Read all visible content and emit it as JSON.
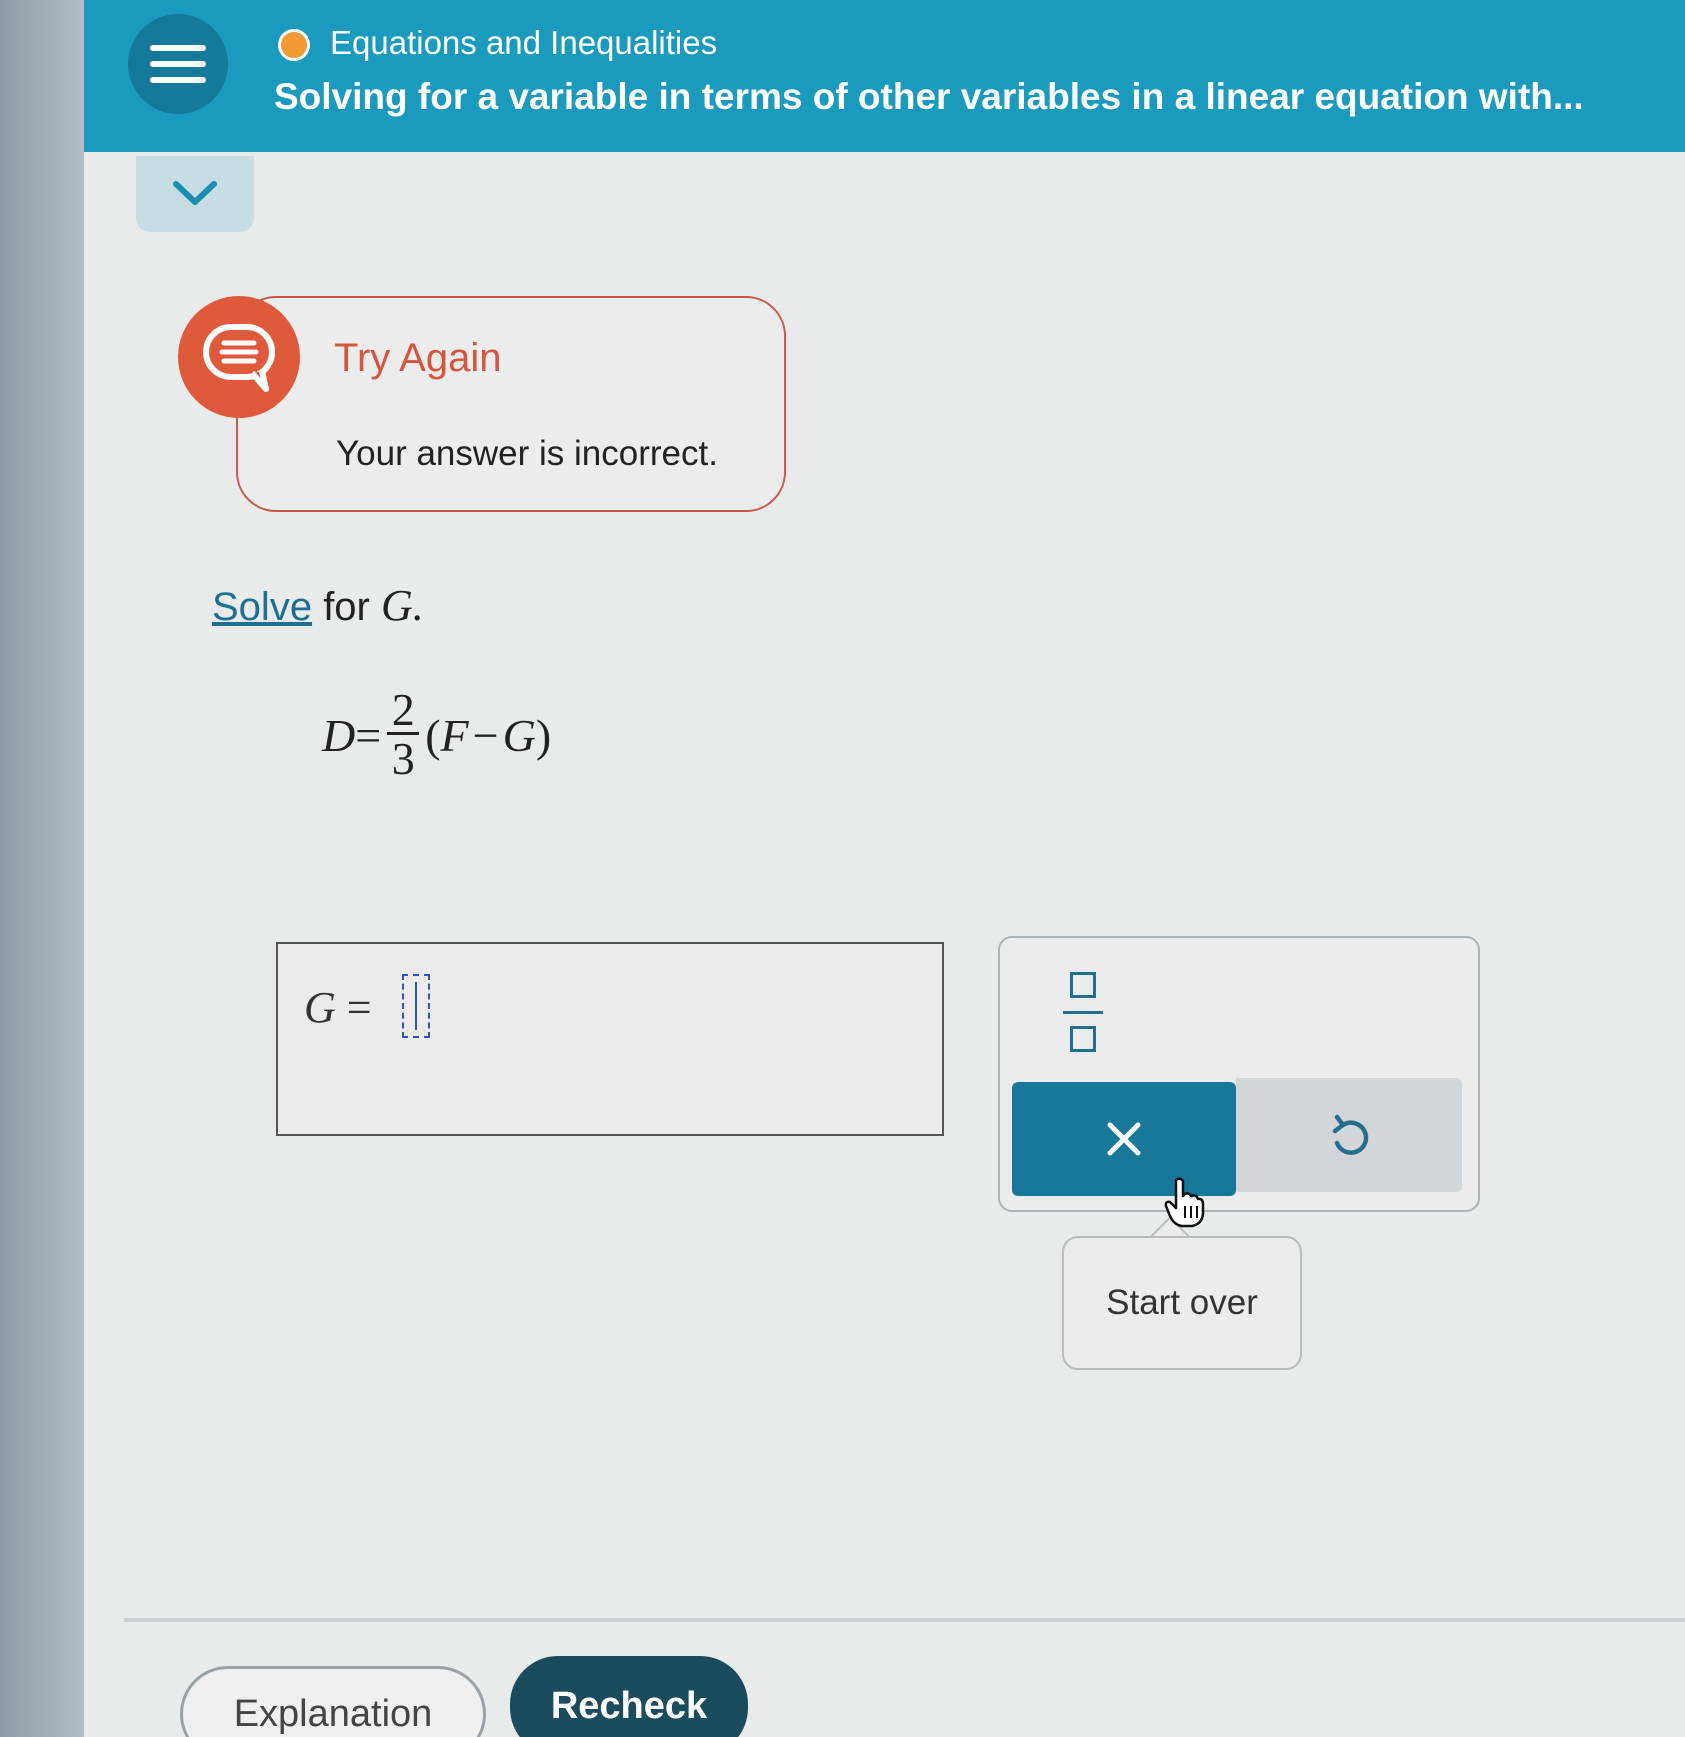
{
  "header": {
    "menu_icon": "hamburger-menu-icon",
    "topic_status_color": "#f29b34",
    "topic": "Equations and Inequalities",
    "subtitle": "Solving for a variable in terms of other variables in a linear equation with..."
  },
  "collapse_icon": "chevron-down-icon",
  "feedback": {
    "icon": "speech-bubble-icon",
    "title": "Try Again",
    "message": "Your answer is incorrect."
  },
  "problem": {
    "instruction_link": "Solve",
    "instruction_rest": "for",
    "variable": "G",
    "period": ".",
    "equation": {
      "lhs": "D",
      "equals": "=",
      "numerator": "2",
      "denominator": "3",
      "open_paren": "(",
      "term1": "F",
      "minus": "−",
      "term2": "G",
      "close_paren": ")"
    }
  },
  "answer": {
    "lhs": "G",
    "equals": "=",
    "value": ""
  },
  "keypad": {
    "fraction_key_icon": "fraction-icon",
    "clear_key_icon": "close-icon",
    "clear_symbol": "✕",
    "undo_key_icon": "undo-icon",
    "tooltip": "Start over"
  },
  "footer": {
    "explanation_label": "Explanation",
    "recheck_label": "Recheck"
  },
  "colors": {
    "header_bg": "#1a9bbd",
    "accent_dark": "#17789a",
    "error": "#df5a3b",
    "recheck_bg": "#1a4c5e"
  }
}
